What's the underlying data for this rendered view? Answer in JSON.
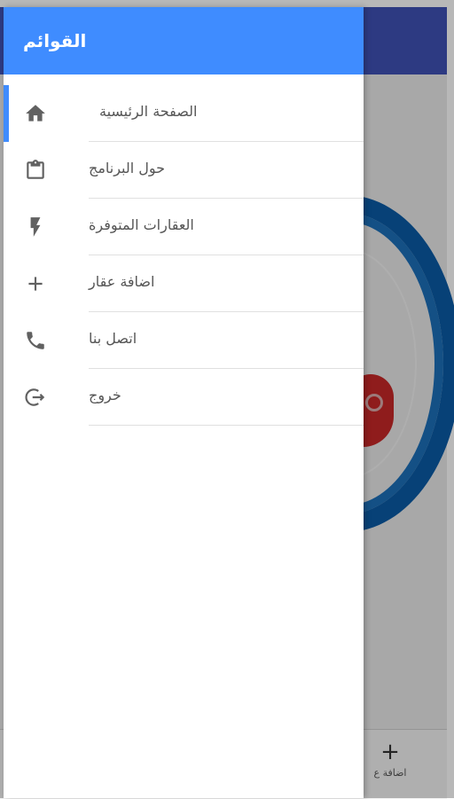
{
  "drawer": {
    "title": "القوائم",
    "items": [
      {
        "label": "الصفحة الرئيسية",
        "icon": "home-icon",
        "active": true
      },
      {
        "label": "حول البرنامج",
        "icon": "clipboard-icon",
        "active": false
      },
      {
        "label": "العقارات المتوفرة",
        "icon": "flash-icon",
        "active": false
      },
      {
        "label": "اضافة عقار",
        "icon": "plus-icon",
        "active": false
      },
      {
        "label": "اتصل بنا",
        "icon": "phone-icon",
        "active": false
      },
      {
        "label": "خروج",
        "icon": "exit-icon",
        "active": false
      }
    ]
  },
  "background": {
    "bottom_nav": {
      "item_label": "اضافة ع"
    }
  },
  "colors": {
    "drawer_header": "#3f8cff",
    "active_accent": "#3f8cff",
    "app_toolbar": "#3f51b5"
  }
}
